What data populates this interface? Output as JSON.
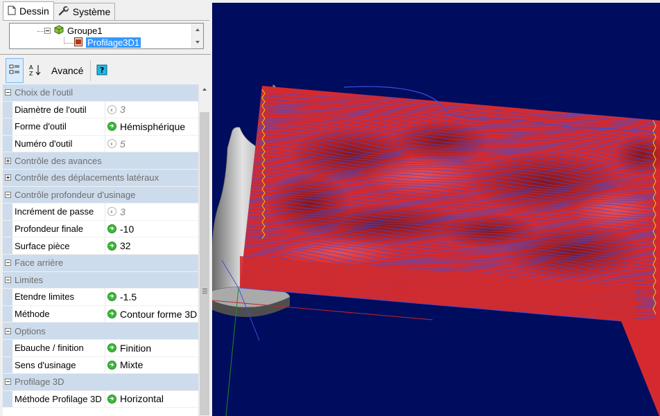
{
  "tabs": [
    {
      "label": "Dessin",
      "icon": "document-icon",
      "active": true
    },
    {
      "label": "Système",
      "icon": "wrench-icon",
      "active": false
    }
  ],
  "tree": {
    "group_label": "Groupe1",
    "item_label": "Profilage3D1"
  },
  "toolbar": {
    "advanced_label": "Avancé",
    "az_label": "A Z",
    "help_label": "?"
  },
  "properties": [
    {
      "category": "Choix de l'outil",
      "expanded": true,
      "items": [
        {
          "name": "Diamètre de l'outil",
          "value": "3",
          "state": "inherited"
        },
        {
          "name": "Forme d'outil",
          "value": "Hémisphérique",
          "state": "set"
        },
        {
          "name": "Numéro d'outil",
          "value": "5",
          "state": "inherited"
        }
      ]
    },
    {
      "category": "Contrôle des avances",
      "expanded": false,
      "items": []
    },
    {
      "category": "Contrôle des déplacements latéraux",
      "expanded": false,
      "items": []
    },
    {
      "category": "Contrôle profondeur d'usinage",
      "expanded": true,
      "items": [
        {
          "name": "Incrément de passe",
          "value": "3",
          "state": "inherited"
        },
        {
          "name": "Profondeur finale",
          "value": "-10",
          "state": "set"
        },
        {
          "name": "Surface pièce",
          "value": "32",
          "state": "set"
        }
      ]
    },
    {
      "category": "Face arrière",
      "expanded": true,
      "items": []
    },
    {
      "category": "Limites",
      "expanded": true,
      "items": [
        {
          "name": "Etendre limites",
          "value": "-1.5",
          "state": "set"
        },
        {
          "name": "Méthode",
          "value": "Contour forme 3D",
          "state": "set"
        }
      ]
    },
    {
      "category": "Options",
      "expanded": true,
      "items": [
        {
          "name": "Ebauche / finition",
          "value": "Finition",
          "state": "set"
        },
        {
          "name": "Sens d'usinage",
          "value": "Mixte",
          "state": "set"
        }
      ]
    },
    {
      "category": "Profilage 3D",
      "expanded": true,
      "items": [
        {
          "name": "Méthode Profilage 3D",
          "value": "Horizontal",
          "state": "set"
        }
      ]
    }
  ],
  "viewport": {
    "background": "#000c5e",
    "surface_color": "#d42a2f",
    "toolpath_color": "#3b4ed8",
    "passes": 70
  }
}
